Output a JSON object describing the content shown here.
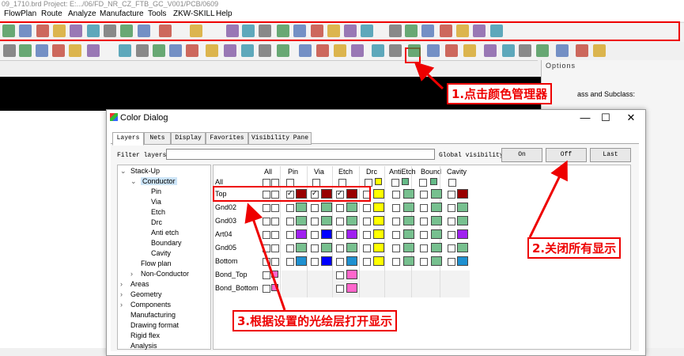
{
  "window": {
    "title": "09_1710.brd  Project: E:.../06/FD_NR_CZ_FTB_GC_V001/PCB/0609"
  },
  "menubar": [
    "FlowPlan",
    "Route",
    "Analyze",
    "Manufacture",
    "Tools",
    "ZKW-SKILL",
    "Help"
  ],
  "options_panel": {
    "title": "Options",
    "text": "ass and Subclass:"
  },
  "dialog": {
    "title": "Color Dialog",
    "tabs": [
      "Layers",
      "Nets",
      "Display",
      "Favorites",
      "Visibility Pane"
    ],
    "filter_label": "Filter layers:",
    "filter_value": "",
    "global_visibility_label": "Global visibility:",
    "buttons": [
      "On",
      "Off",
      "Last"
    ]
  },
  "tree": [
    {
      "label": "Stack-Up",
      "level": 0,
      "expander": "⌄"
    },
    {
      "label": "Conductor",
      "level": 1,
      "expander": "⌄",
      "selected": true
    },
    {
      "label": "Pin",
      "level": 2
    },
    {
      "label": "Via",
      "level": 2
    },
    {
      "label": "Etch",
      "level": 2
    },
    {
      "label": "Drc",
      "level": 2
    },
    {
      "label": "Anti etch",
      "level": 2
    },
    {
      "label": "Boundary",
      "level": 2
    },
    {
      "label": "Cavity",
      "level": 2
    },
    {
      "label": "Flow plan",
      "level": 1
    },
    {
      "label": "Non-Conductor",
      "level": 1,
      "expander": "›"
    },
    {
      "label": "Areas",
      "level": 0,
      "expander": "›"
    },
    {
      "label": "Geometry",
      "level": 0,
      "expander": "›"
    },
    {
      "label": "Components",
      "level": 0,
      "expander": "›"
    },
    {
      "label": "Manufacturing",
      "level": 0
    },
    {
      "label": "Drawing format",
      "level": 0
    },
    {
      "label": "Rigid flex",
      "level": 0
    },
    {
      "label": "Analysis",
      "level": 0
    }
  ],
  "grid": {
    "columns": [
      "All",
      "Pin",
      "Via",
      "Etch",
      "Drc",
      "AntiEtch",
      "Bound",
      "Cavity"
    ],
    "header_row_label": "All",
    "header_swatches": [
      "#ffff00",
      "#66bb88",
      "#66bb88"
    ],
    "rows": [
      {
        "label": "Top",
        "pin": "#990000",
        "via": "#990000",
        "etch": "#990000",
        "drc": "#ffff00",
        "anti": "#77c08f",
        "bound": "#77c08f",
        "cavity": "#990000",
        "checked": true
      },
      {
        "label": "Gnd02",
        "pin": "#77c08f",
        "via": "#77c08f",
        "etch": "#77c08f",
        "drc": "#ffff00",
        "anti": "#77c08f",
        "bound": "#77c08f",
        "cavity": "#77c08f",
        "checked": false
      },
      {
        "label": "Gnd03",
        "pin": "#77c08f",
        "via": "#77c08f",
        "etch": "#77c08f",
        "drc": "#ffff00",
        "anti": "#77c08f",
        "bound": "#77c08f",
        "cavity": "#77c08f",
        "checked": false
      },
      {
        "label": "Art04",
        "pin": "#a020f0",
        "via": "#0000ff",
        "etch": "#a020f0",
        "drc": "#ffff00",
        "anti": "#77c08f",
        "bound": "#77c08f",
        "cavity": "#a020f0",
        "checked": false
      },
      {
        "label": "Gnd05",
        "pin": "#77c08f",
        "via": "#77c08f",
        "etch": "#77c08f",
        "drc": "#ffff00",
        "anti": "#77c08f",
        "bound": "#77c08f",
        "cavity": "#77c08f",
        "checked": false
      },
      {
        "label": "Bottom",
        "pin": "#1e90d0",
        "via": "#0000ff",
        "etch": "#1e90d0",
        "drc": "#ffff00",
        "anti": "#77c08f",
        "bound": "#77c08f",
        "cavity": "#1e90d0",
        "checked": false
      },
      {
        "label": "Bond_Top",
        "all_swatch": "#ff66cc",
        "etch": "#ff66cc",
        "checked": false,
        "bond": true
      },
      {
        "label": "Bond_Bottom",
        "all_swatch": "#ff66cc",
        "etch": "#ff66cc",
        "checked": false,
        "bond": true
      }
    ]
  },
  "annotations": {
    "a1": "1.点击颜色管理器",
    "a2": "2.关闭所有显示",
    "a3": "3.根据设置的光绘层打开显示"
  },
  "colors": {
    "annotation_red": "#e00000",
    "layer_green": "#77c08f",
    "drc_yellow": "#ffff00"
  }
}
